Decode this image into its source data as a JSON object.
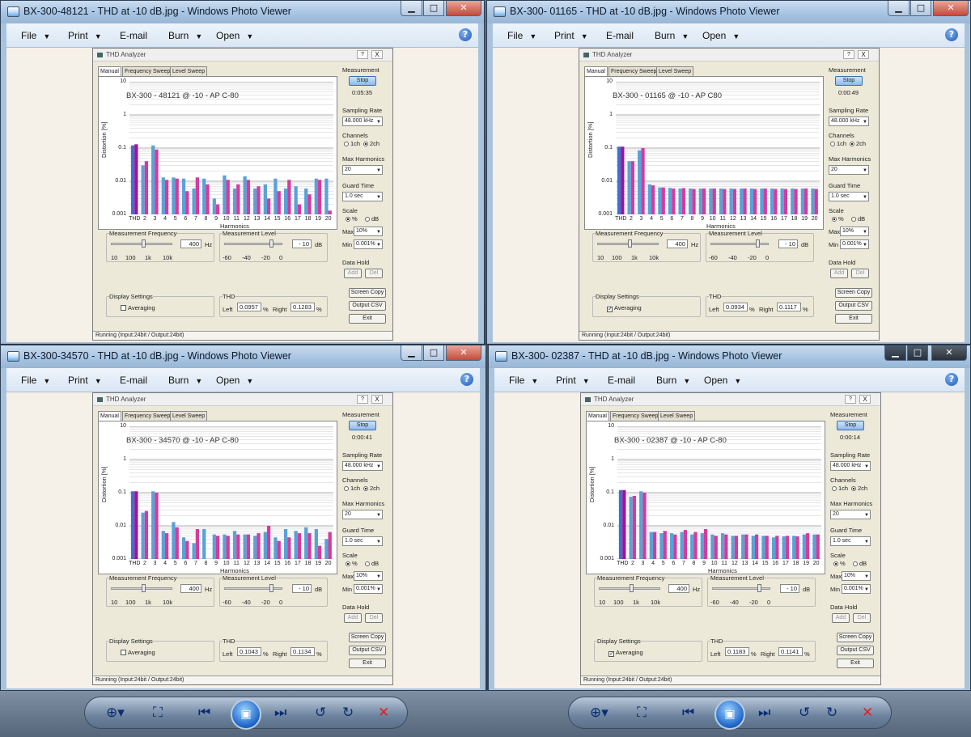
{
  "windows": [
    {
      "title": "BX-300-48121 - THD at -10 dB.jpg - Windows Photo Viewer",
      "annotation": "BX-300 - 48121 @ -10 - AP C-80",
      "elapsed": "0:05:35",
      "thd_left": "0.0957",
      "thd_right": "0.1283",
      "avg_checked": false,
      "status": "Running (Input:24bit / Output:24bit)",
      "stop_label": "Stop",
      "series_left": [
        0.12,
        0.03,
        0.12,
        0.013,
        0.013,
        0.012,
        0.006,
        0.012,
        0.003,
        0.015,
        0.006,
        0.014,
        0.006,
        0.008,
        0.012,
        0.006,
        0.007,
        0.006,
        0.012,
        0.012
      ],
      "series_right": [
        0.13,
        0.04,
        0.09,
        0.011,
        0.012,
        0.005,
        0.013,
        0.008,
        0.002,
        0.011,
        0.008,
        0.011,
        0.007,
        0.003,
        0.005,
        0.011,
        0.002,
        0.004,
        0.011,
        0.0013
      ]
    },
    {
      "title": "BX-300- 01165 - THD at -10 dB.jpg - Windows Photo Viewer",
      "annotation": "BX-300 - 01165 @ -10 - AP C80",
      "elapsed": "0:00:49",
      "thd_left": "0.0934",
      "thd_right": "0.1117",
      "avg_checked": true,
      "status": "Running (Input:24bit / Output:24bit)",
      "stop_label": "Stop",
      "series_left": [
        0.11,
        0.04,
        0.085,
        0.008,
        0.0065,
        0.0063,
        0.006,
        0.006,
        0.006,
        0.006,
        0.006,
        0.006,
        0.006,
        0.006,
        0.006,
        0.006,
        0.006,
        0.006,
        0.006,
        0.006
      ],
      "series_right": [
        0.11,
        0.04,
        0.1,
        0.0075,
        0.0065,
        0.006,
        0.0062,
        0.0058,
        0.006,
        0.006,
        0.0058,
        0.0058,
        0.006,
        0.0058,
        0.006,
        0.0058,
        0.0058,
        0.0058,
        0.006,
        0.0058
      ]
    },
    {
      "title": "BX-300-34570 - THD at -10 dB.jpg - Windows Photo Viewer",
      "annotation": "BX-300 - 34570 @ -10 - AP C-80",
      "elapsed": "0:00:41",
      "thd_left": "0.1043",
      "thd_right": "0.1134",
      "avg_checked": false,
      "status": "Running (Input:24bit / Output:24bit)",
      "stop_label": "Stop",
      "series_left": [
        0.11,
        0.025,
        0.11,
        0.007,
        0.013,
        0.0045,
        0.003,
        0.008,
        0.0055,
        0.0055,
        0.007,
        0.0055,
        0.005,
        0.0065,
        0.0045,
        0.008,
        0.007,
        0.009,
        0.008,
        0.004
      ],
      "series_right": [
        0.11,
        0.028,
        0.1,
        0.006,
        0.009,
        0.0035,
        0.008,
        0.001,
        0.005,
        0.005,
        0.0055,
        0.0055,
        0.006,
        0.01,
        0.0035,
        0.0045,
        0.006,
        0.006,
        0.0025,
        0.0065
      ]
    },
    {
      "title": "BX-300- 02387 - THD at -10 dB.jpg - Windows Photo Viewer",
      "annotation": "BX-300 - 02387 @ -10 - AP C-80",
      "elapsed": "0:00:14",
      "thd_left": "0.1183",
      "thd_right": "0.1141",
      "avg_checked": true,
      "status": "Running (Input:24bit / Output:24bit)",
      "stop_label": "Stop",
      "series_left": [
        0.12,
        0.075,
        0.11,
        0.0065,
        0.006,
        0.006,
        0.0065,
        0.0055,
        0.006,
        0.0055,
        0.006,
        0.005,
        0.0055,
        0.005,
        0.005,
        0.0045,
        0.0048,
        0.005,
        0.0055,
        0.0055
      ],
      "series_right": [
        0.12,
        0.08,
        0.1,
        0.0065,
        0.007,
        0.0055,
        0.0075,
        0.0065,
        0.008,
        0.005,
        0.0055,
        0.005,
        0.0055,
        0.0055,
        0.005,
        0.005,
        0.005,
        0.0048,
        0.006,
        0.0055
      ]
    }
  ],
  "menu": {
    "file": "File",
    "print": "Print",
    "email": "E-mail",
    "burn": "Burn",
    "open": "Open",
    "help": "?"
  },
  "thd_window": {
    "title": "THD Analyzer",
    "help_btn": "?",
    "close_btn": "X",
    "tabs": [
      "Manual",
      "Frequency Sweep",
      "Level Sweep"
    ],
    "ylabel": "Distortion [%]",
    "xlabel": "Harmonics",
    "measurement_label": "Measurement",
    "sampling_rate_label": "Sampling Rate",
    "sampling_rate_value": "48.000 kHz",
    "channels_label": "Channels",
    "ch1": "1ch",
    "ch2": "2ch",
    "max_harmonics_label": "Max Harmonics",
    "max_harmonics_value": "20",
    "guard_time_label": "Guard Time",
    "guard_time_value": "1.0 sec",
    "scale_label": "Scale",
    "scale_pct": "%",
    "scale_db": "dB",
    "max_label": "Max",
    "max_value": "10%",
    "min_label": "Min",
    "min_value": "0.001%",
    "data_hold_label": "Data Hold",
    "add_btn": "Add",
    "del_btn": "Del",
    "screen_copy_btn": "Screen Copy",
    "output_csv_btn": "Output CSV",
    "exit_btn": "Exit",
    "meas_freq_label": "Measurement Frequency",
    "meas_freq_value": "400",
    "hz": "Hz",
    "freq_ticks": [
      "10",
      "100",
      "1k",
      "10k"
    ],
    "meas_level_label": "Measurement Level",
    "meas_level_value": "- 10",
    "db": "dB",
    "level_ticks": [
      "-60",
      "-40",
      "-20",
      "0"
    ],
    "display_settings_label": "Display Settings",
    "averaging_label": "Averaging",
    "thd_label": "THD",
    "left_label": "Left",
    "right_label": "Right",
    "pct": "%",
    "yticks": [
      "10",
      "1",
      "0.1",
      "0.01",
      "0.001"
    ],
    "xticks": [
      "THD",
      "2",
      "3",
      "4",
      "5",
      "6",
      "7",
      "8",
      "9",
      "10",
      "11",
      "12",
      "13",
      "14",
      "15",
      "16",
      "17",
      "18",
      "19",
      "20"
    ]
  },
  "colors": {
    "left_series": "#5aa2d6",
    "left_series_dark": "#3f6fd0",
    "right_series": "#d63a9e",
    "right_series_dark": "#a0129a",
    "accent": "#1c58b8"
  },
  "navbar": {
    "zoom_icon": "zoom-icon",
    "fit_icon": "actual-size-icon",
    "prev_icon": "previous-icon",
    "play_icon": "slideshow-icon",
    "next_icon": "next-icon",
    "rotate_ccw_icon": "rotate-counterclockwise-icon",
    "rotate_cw_icon": "rotate-clockwise-icon",
    "delete_icon": "delete-icon"
  }
}
